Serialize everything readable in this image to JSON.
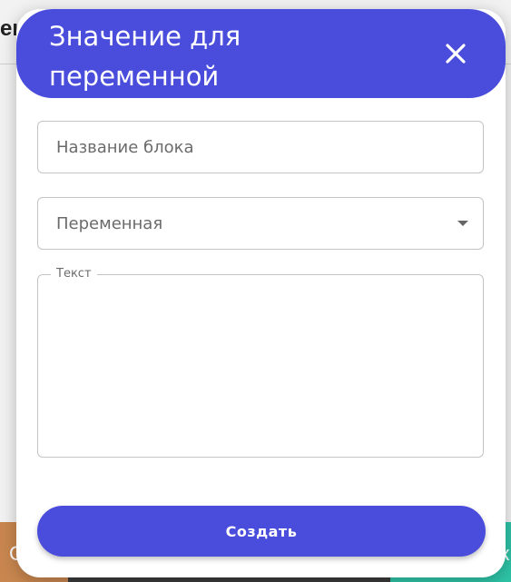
{
  "background": {
    "heading_fragment": "ен",
    "bottom_left_char": "С",
    "bottom_right_char": "к"
  },
  "dialog": {
    "title": "Значение для переменной",
    "close_icon": "close-icon",
    "block_name": {
      "placeholder": "Название блока",
      "value": ""
    },
    "variable_select": {
      "selected": "Переменная",
      "icon": "dropdown-arrow-icon"
    },
    "text_field": {
      "label": "Текст",
      "value": ""
    },
    "submit_label": "Создать"
  },
  "colors": {
    "accent": "#4a4ddb",
    "border": "#c4c4c4",
    "placeholder": "#6b6b6b"
  }
}
